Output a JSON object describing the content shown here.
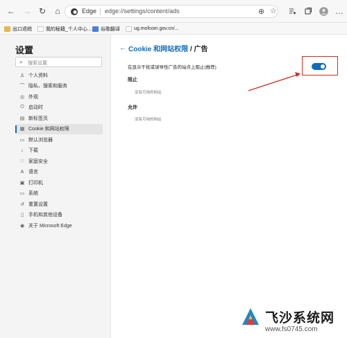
{
  "toolbar": {
    "back_icon": "back-arrow",
    "forward_icon": "forward-arrow",
    "refresh_icon": "refresh",
    "home_icon": "home",
    "site_name": "Edge",
    "url": "edge://settings/content/ads",
    "zoom_icon": "zoom-in",
    "favorite_icon": "star",
    "favorites_bar_icon": "favorites-list",
    "collections_icon": "collections",
    "profile_icon": "profile",
    "menu_icon": "more"
  },
  "bookmarks": [
    {
      "label": "出口退税",
      "icon": "folder"
    },
    {
      "label": "我的秘籍_个人中心...",
      "icon": "page"
    },
    {
      "label": "谷歌翻译",
      "icon": "page"
    },
    {
      "label": "ug.mofcom.gov.cn/...",
      "icon": "page"
    }
  ],
  "sidebar": {
    "title": "设置",
    "search_placeholder": "搜索设置",
    "items": [
      {
        "label": "个人资料",
        "icon": "person"
      },
      {
        "label": "隐私、搜索和服务",
        "icon": "lock"
      },
      {
        "label": "外观",
        "icon": "palette"
      },
      {
        "label": "启动时",
        "icon": "power"
      },
      {
        "label": "新标签页",
        "icon": "tab"
      },
      {
        "label": "Cookie 和网站权限",
        "icon": "cookie"
      },
      {
        "label": "默认浏览器",
        "icon": "browser"
      },
      {
        "label": "下载",
        "icon": "download"
      },
      {
        "label": "家庭安全",
        "icon": "family"
      },
      {
        "label": "语言",
        "icon": "language"
      },
      {
        "label": "打印机",
        "icon": "printer"
      },
      {
        "label": "系统",
        "icon": "computer"
      },
      {
        "label": "重置设置",
        "icon": "reset"
      },
      {
        "label": "手机和其他设备",
        "icon": "phone"
      },
      {
        "label": "关于 Microsoft Edge",
        "icon": "edge"
      }
    ],
    "active_index": 5
  },
  "main": {
    "breadcrumb_parent": "Cookie 和网站权限",
    "breadcrumb_separator": " / ",
    "breadcrumb_current": "广告",
    "setting_label": "在显示干扰或误导性广告的站点上阻止(推荐)",
    "toggle_on": true,
    "block_title": "阻止",
    "block_empty": "没有可用的网站",
    "allow_title": "允许",
    "allow_empty": "没有可用的网站"
  },
  "watermark": {
    "name": "飞沙系统网",
    "domain": "www.fs0745.com"
  },
  "colors": {
    "accent": "#0f6cbd",
    "annotation": "#d9261c"
  }
}
